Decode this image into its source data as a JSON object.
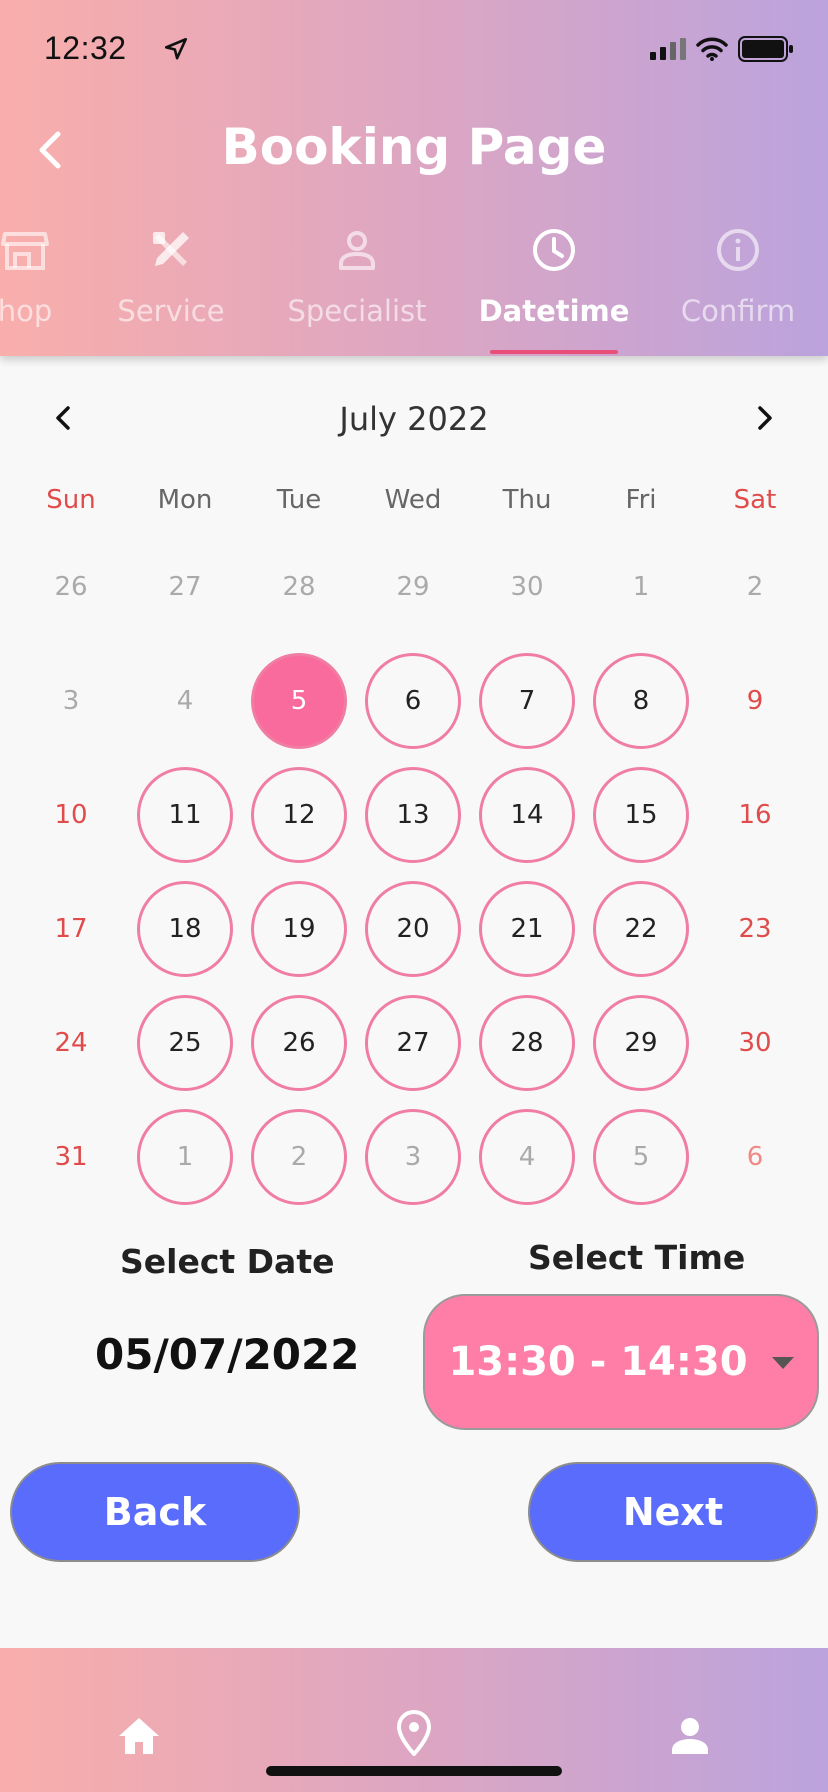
{
  "status_bar": {
    "time": "12:32"
  },
  "header": {
    "title": "Booking Page"
  },
  "tabs": [
    {
      "label": "hop",
      "icon": "store-icon"
    },
    {
      "label": "Service",
      "icon": "tools-icon"
    },
    {
      "label": "Specialist",
      "icon": "person-icon"
    },
    {
      "label": "Datetime",
      "icon": "clock-icon",
      "active": true
    },
    {
      "label": "Confirm",
      "icon": "info-icon"
    }
  ],
  "calendar": {
    "month_label": "July 2022",
    "weekdays": [
      "Sun",
      "Mon",
      "Tue",
      "Wed",
      "Thu",
      "Fri",
      "Sat"
    ],
    "selected_day": "5",
    "weeks": [
      [
        "26",
        "27",
        "28",
        "29",
        "30",
        "1",
        "2"
      ],
      [
        "3",
        "4",
        "5",
        "6",
        "7",
        "8",
        "9"
      ],
      [
        "10",
        "11",
        "12",
        "13",
        "14",
        "15",
        "16"
      ],
      [
        "17",
        "18",
        "19",
        "20",
        "21",
        "22",
        "23"
      ],
      [
        "24",
        "25",
        "26",
        "27",
        "28",
        "29",
        "30"
      ],
      [
        "31",
        "1",
        "2",
        "3",
        "4",
        "5",
        "6"
      ]
    ]
  },
  "select_date": {
    "label": "Select Date",
    "value": "05/07/2022"
  },
  "select_time": {
    "label": "Select Time",
    "value": "13:30 - 14:30"
  },
  "buttons": {
    "back": "Back",
    "next": "Next"
  },
  "colors": {
    "accent_pink": "#ff7ea7",
    "button_blue": "#5a6cfb",
    "weekend_red": "#e04b4b"
  }
}
